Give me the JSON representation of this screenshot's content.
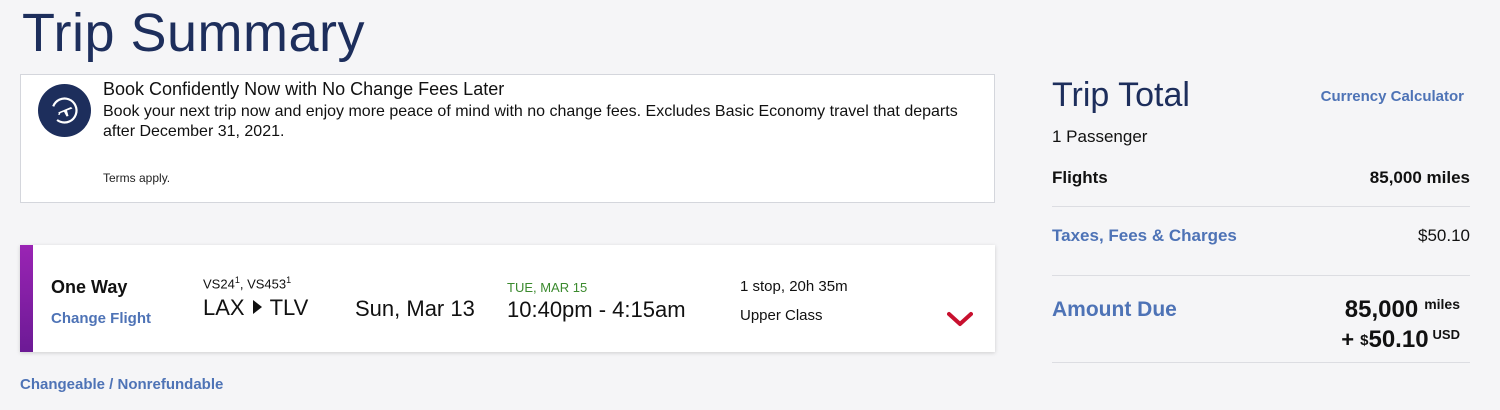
{
  "page": {
    "title": "Trip Summary"
  },
  "notice": {
    "icon": "plane-icon",
    "title": "Book Confidently Now with No Change Fees Later",
    "text": "Book your next trip now and enjoy more peace of mind with no change fees. Excludes Basic Economy travel that departs after December 31, 2021.",
    "terms": "Terms apply."
  },
  "flight": {
    "trip_type": "One Way",
    "change_link": "Change Flight",
    "flight_numbers": [
      {
        "code": "VS24",
        "footnote": "1"
      },
      {
        "code": "VS453",
        "footnote": "1"
      }
    ],
    "origin": "LAX",
    "destination": "TLV",
    "departure_date": "Sun, Mar 13",
    "arrival_date": "TUE, MAR 15",
    "times": "10:40pm - 4:15am",
    "stops": "1 stop, 20h 35m",
    "cabin": "Upper Class",
    "expand_icon": "chevron-down-icon"
  },
  "fare_rules": "Changeable / Nonrefundable",
  "summary": {
    "title": "Trip Total",
    "currency_link": "Currency Calculator",
    "passengers": "1 Passenger",
    "flights_label": "Flights",
    "flights_value": "85,000 miles",
    "taxes_label": "Taxes, Fees & Charges",
    "taxes_value": "$50.10",
    "amount_due_label": "Amount Due",
    "amount_due_miles": "85,000",
    "miles_unit": "miles",
    "plus": "+",
    "currency_symbol": "$",
    "amount_due_cash": "50.10",
    "cash_unit": "USD"
  },
  "colors": {
    "navy": "#1d2e5c",
    "link_blue": "#4e73b6",
    "arrival_green": "#3b8a2e",
    "chevron_red": "#c8102e",
    "stripe_purple": "#8a1fb0"
  }
}
